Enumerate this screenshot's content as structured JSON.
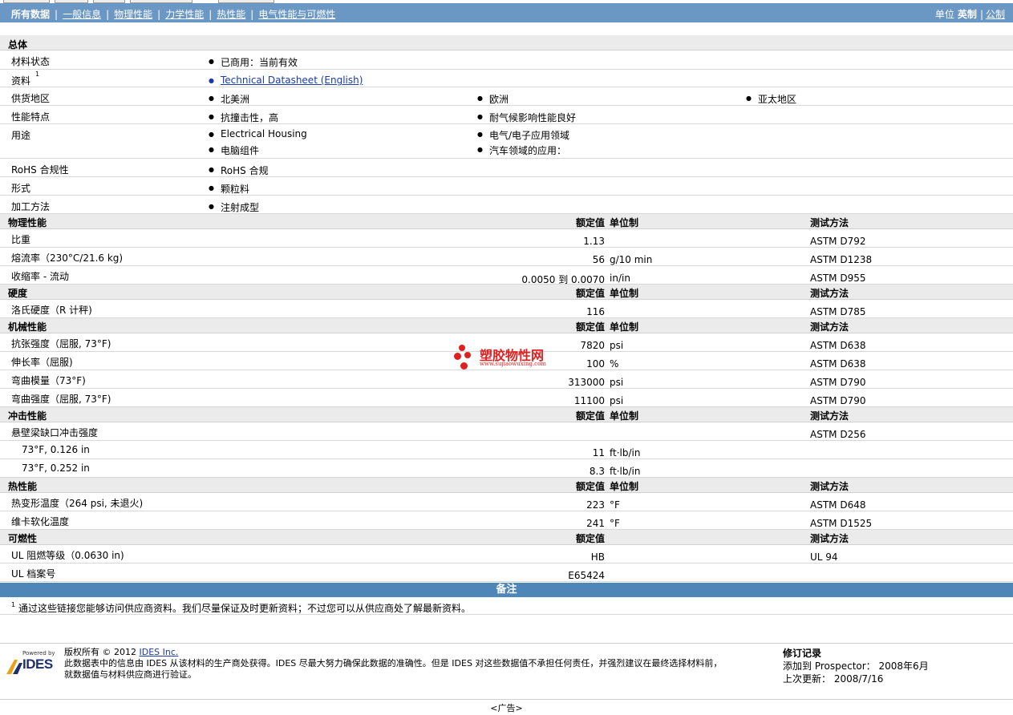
{
  "nav": {
    "items": [
      "所有数据",
      "一般信息",
      "物理性能",
      "力学性能",
      "热性能",
      "电气性能与可燃性"
    ],
    "units_label": "单位",
    "unit_current": "英制",
    "unit_alt": "公制"
  },
  "general": {
    "heading": "总体",
    "rows": [
      {
        "label": "材料状态",
        "values": [
          "已商用：当前有效"
        ]
      },
      {
        "label": "资料",
        "sup": "1",
        "values": [
          "Technical Datasheet (English)"
        ]
      },
      {
        "label": "供货地区",
        "values": [
          "北美洲",
          "欧洲",
          "亚太地区"
        ]
      },
      {
        "label": "性能特点",
        "values": [
          "抗撞击性，高",
          "耐气候影响性能良好"
        ]
      },
      {
        "label": "用途",
        "values": [
          "Electrical Housing",
          "电气/电子应用领域",
          "电脑组件",
          "汽车领域的应用："
        ]
      },
      {
        "label": "RoHS 合规性",
        "values": [
          "RoHS 合规"
        ]
      },
      {
        "label": "形式",
        "values": [
          "颗粒料"
        ]
      },
      {
        "label": "加工方法",
        "values": [
          "注射成型"
        ]
      }
    ]
  },
  "col_headers": {
    "nominal": "额定值",
    "unit": "单位制",
    "method": "测试方法"
  },
  "sections": [
    {
      "heading": "物理性能",
      "rows": [
        {
          "label": "比重",
          "value": "1.13",
          "unit": "",
          "method": "ASTM D792"
        },
        {
          "label": "熔流率（230°C/21.6 kg)",
          "value": "56",
          "unit": "g/10 min",
          "method": "ASTM D1238"
        },
        {
          "label": "收缩率 - 流动",
          "value": "0.0050 到 0.0070",
          "unit": "in/in",
          "method": "ASTM D955"
        }
      ]
    },
    {
      "heading": "硬度",
      "rows": [
        {
          "label": "洛氏硬度（R 计秤)",
          "value": "116",
          "unit": "",
          "method": "ASTM D785"
        }
      ]
    },
    {
      "heading": "机械性能",
      "rows": [
        {
          "label": "抗张强度（屈服, 73°F)",
          "value": "7820",
          "unit": "psi",
          "method": "ASTM D638"
        },
        {
          "label": "伸长率（屈服)",
          "value": "100",
          "unit": "%",
          "method": "ASTM D638"
        },
        {
          "label": "弯曲模量（73°F)",
          "value": "313000",
          "unit": "psi",
          "method": "ASTM D790"
        },
        {
          "label": "弯曲强度（屈服, 73°F)",
          "value": "11100",
          "unit": "psi",
          "method": "ASTM D790"
        }
      ]
    },
    {
      "heading": "冲击性能",
      "rows": [
        {
          "label": "悬壁梁缺口冲击强度",
          "value": "",
          "unit": "",
          "method": "ASTM D256"
        },
        {
          "label": "73°F, 0.126 in",
          "indent": true,
          "value": "11",
          "unit": "ft·lb/in",
          "method": ""
        },
        {
          "label": "73°F, 0.252 in",
          "indent": true,
          "value": "8.3",
          "unit": "ft·lb/in",
          "method": ""
        }
      ]
    },
    {
      "heading": "热性能",
      "rows": [
        {
          "label": "热变形温度（264 psi, 未退火)",
          "value": "223",
          "unit": "°F",
          "method": "ASTM D648"
        },
        {
          "label": "维卡软化温度",
          "value": "241",
          "unit": "°F",
          "method": "ASTM D1525"
        }
      ]
    },
    {
      "heading": "可燃性",
      "no_unit": true,
      "rows": [
        {
          "label": "UL 阻燃等级（0.0630 in)",
          "value": "HB",
          "unit": "",
          "method": "UL 94"
        },
        {
          "label": "UL 档案号",
          "value": "E65424",
          "unit": "",
          "method": ""
        }
      ]
    }
  ],
  "notes": {
    "heading": "备注",
    "items": [
      {
        "num": "1",
        "text": "通过这些链接您能够访问供应商资料。我们尽量保证及时更新资料；不过您可以从供应商处了解最新资料。"
      }
    ]
  },
  "watermark": {
    "title": "塑胶物性网",
    "url": "www.sujiaowuxing.com"
  },
  "footer": {
    "powered_by": "Powered by",
    "logo_text": "IDES",
    "copyright_label": "版权所有",
    "copyright_year": "© 2012",
    "company": "IDES Inc.",
    "disclaimer_line1": "此数据表中的信息由 IDES 从该材料的生产商处获得。IDES 尽最大努力确保此数据的准确性。但是 IDES 对这些数据值不承担任何责任，并强烈建议在最终选择材料前，",
    "disclaimer_line2": "就数据值与材料供应商进行验证。",
    "revision_title": "修订记录",
    "added_label": "添加到 Prospector：",
    "added_value": "2008年6月",
    "updated_label": "上次更新：",
    "updated_value": "2008/7/16"
  },
  "ad": "<广告>"
}
